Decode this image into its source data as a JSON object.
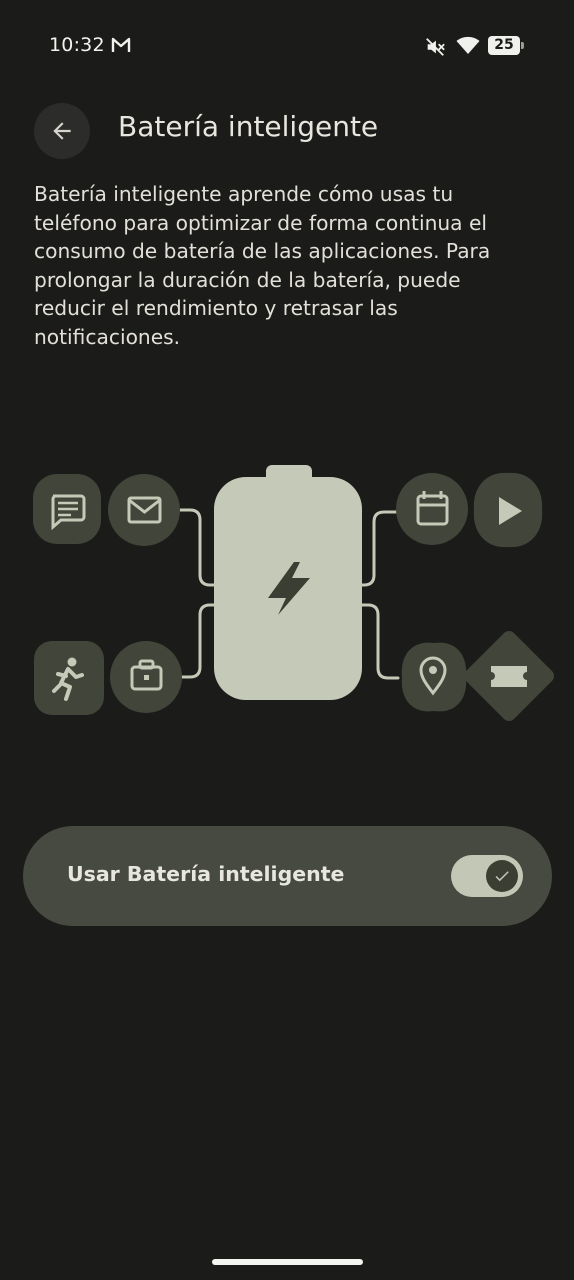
{
  "status_bar": {
    "time": "10:32",
    "battery_level": "25",
    "icons": [
      "gmail-icon",
      "mute-icon",
      "wifi-icon",
      "battery-icon"
    ]
  },
  "header": {
    "back_icon": "arrow-back-icon",
    "title": "Batería inteligente"
  },
  "description": "Batería inteligente aprende cómo usas tu teléfono para optimizar de forma continua el consumo de batería de las aplicaciones. Para prolongar la duración de la batería, puede reducir el rendimiento y retrasar las notificaciones.",
  "illustration": {
    "left_apps": [
      "message-icon",
      "mail-icon",
      "running-icon",
      "briefcase-icon"
    ],
    "right_apps": [
      "calendar-icon",
      "play-icon",
      "location-icon",
      "ticket-icon"
    ],
    "center_icon": "battery-bolt-icon"
  },
  "toggle": {
    "label": "Usar Batería inteligente",
    "checked": true
  },
  "colors": {
    "background": "#1b1b19",
    "toggle_row": "#474a40",
    "switch_track": "#c3c8b6",
    "app_bubble": "#424539",
    "battery_body": "#c5c9b8"
  }
}
